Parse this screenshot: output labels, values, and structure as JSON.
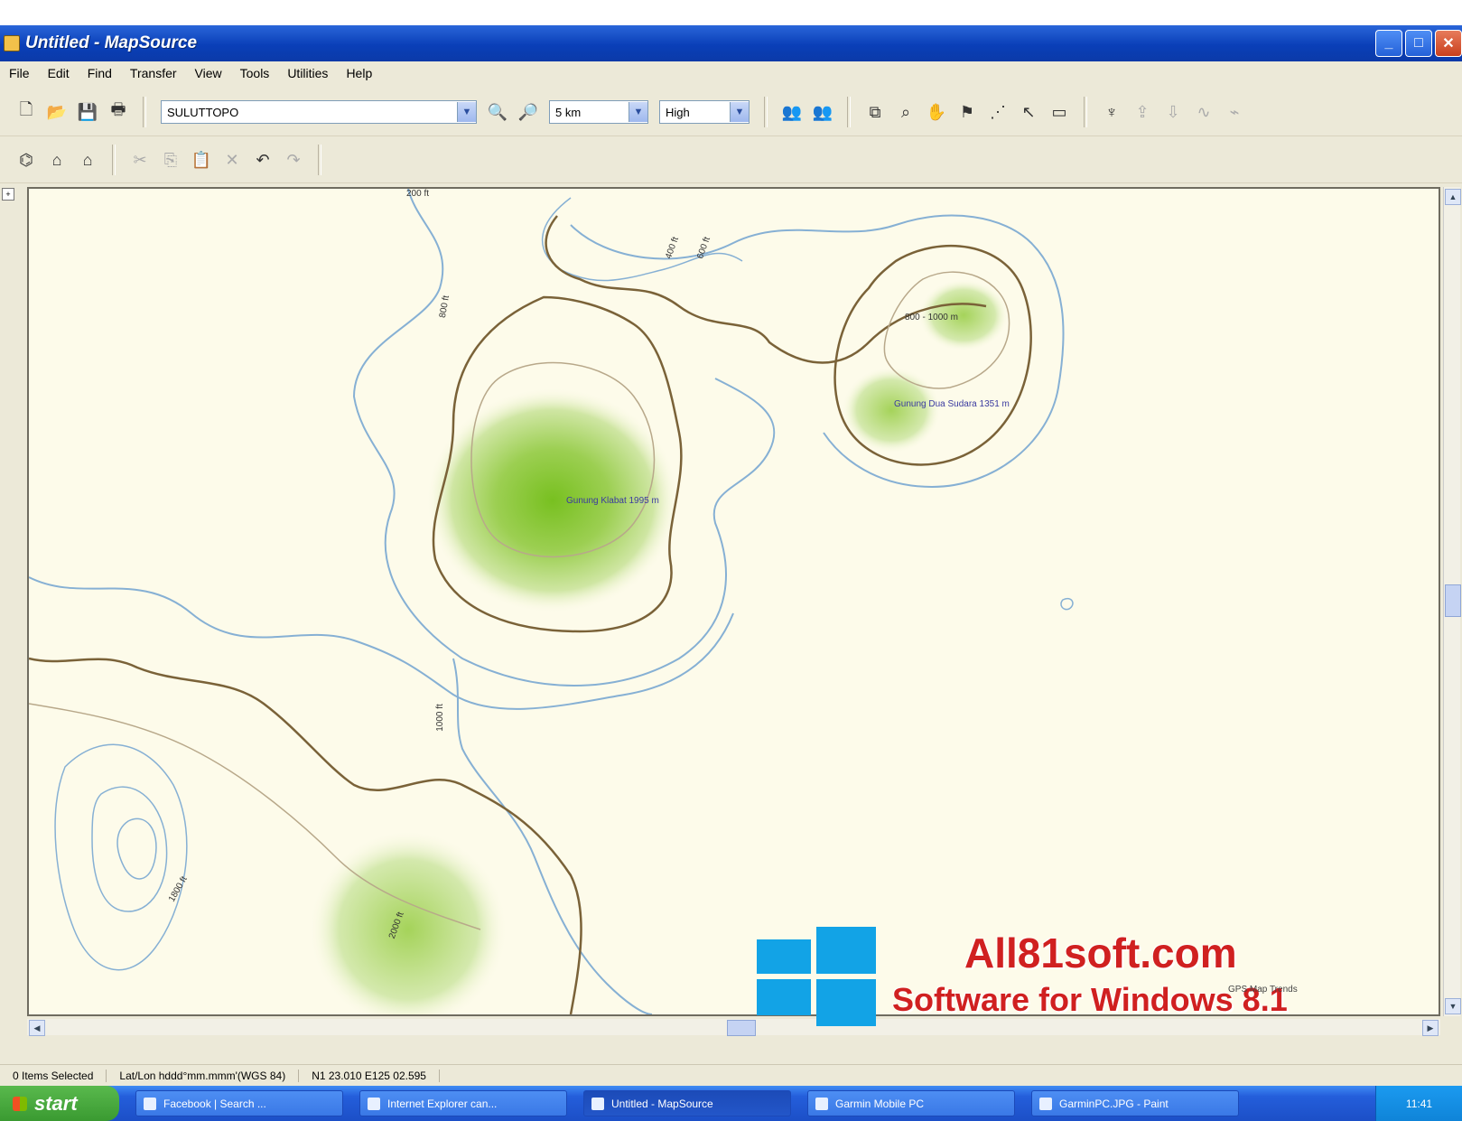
{
  "window": {
    "title": "Untitled - MapSource"
  },
  "menu": [
    "File",
    "Edit",
    "Find",
    "Transfer",
    "View",
    "Tools",
    "Utilities",
    "Help"
  ],
  "toolbar": {
    "map_product": "SULUTTOPO",
    "zoom_scale": "5 km",
    "detail": "High"
  },
  "map": {
    "labels": {
      "elev_range": "800 - 1000 m",
      "peak1": "Gunung Klabat 1995 m",
      "peak2": "Gunung Dua Sudara 1351 m",
      "contour_200": "200 ft",
      "contour_a": "400 ft",
      "contour_b": "600 ft",
      "contour_c": "800 ft",
      "contour_d": "1000 ft",
      "contour_e": "2000 ft",
      "contour_f": "1800 ft"
    }
  },
  "status": {
    "selected": "0 Items Selected",
    "format": "Lat/Lon hddd°mm.mmm'(WGS 84)",
    "position": "N1 23.010 E125 02.595"
  },
  "taskbar": {
    "start": "start",
    "items": [
      "Facebook | Search ...",
      "Internet Explorer can...",
      "Untitled - MapSource",
      "Garmin Mobile PC",
      "GarminPC.JPG - Paint"
    ],
    "clock": "11:41"
  },
  "watermark": {
    "site": "All81soft.com",
    "tagline": "Software for Windows 8.1",
    "note": "GPS Map Trends"
  },
  "colors": {
    "titlebar": "#0a3fb8",
    "map_bg": "#fdfbea",
    "contour_blue": "#7fa6c9",
    "contour_brown": "#7a6238",
    "peak_green": "#8cc63f",
    "watermark_red": "#d02020",
    "windows_blue": "#12a3e6"
  }
}
